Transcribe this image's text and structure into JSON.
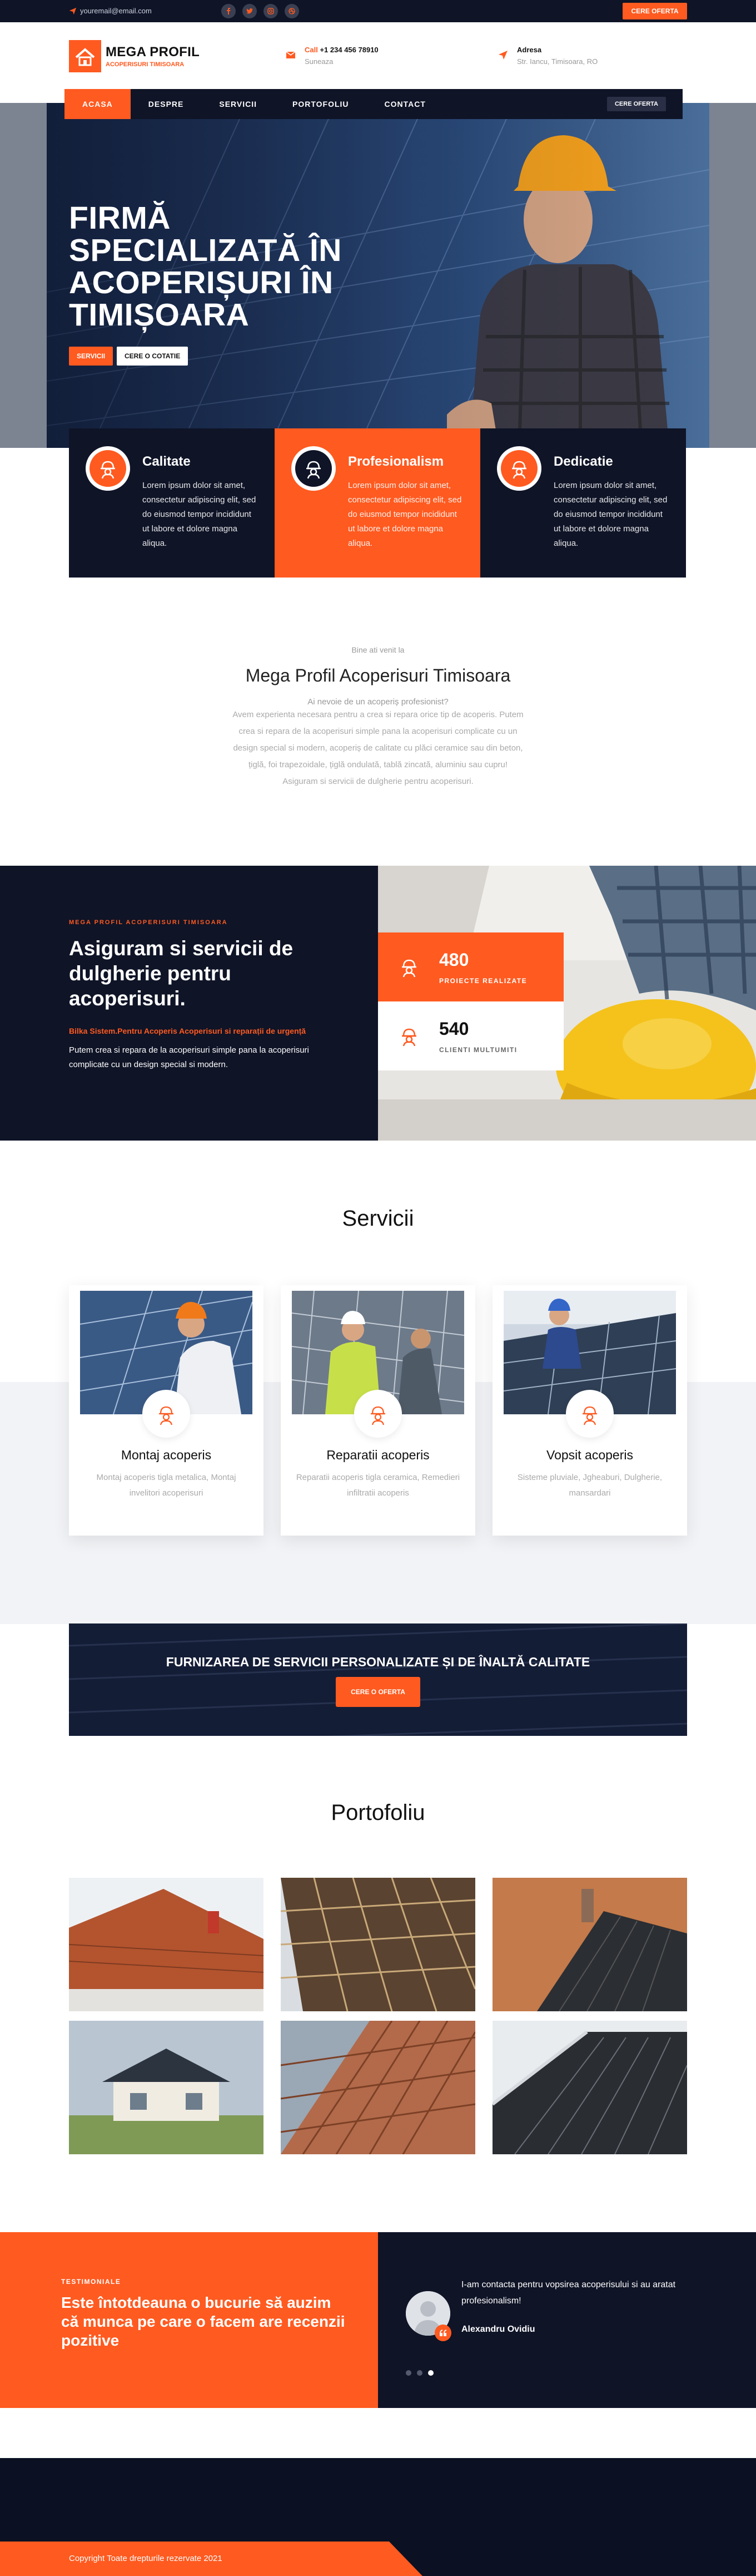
{
  "topbar": {
    "email": "youremail@email.com",
    "cta": "CERE OFERTA",
    "social": [
      "facebook-icon",
      "twitter-icon",
      "instagram-icon",
      "dribbble-icon"
    ]
  },
  "header": {
    "logo_title": "MEGA PROFIL",
    "logo_sub": "ACOPERISURI TIMISOARA",
    "call_label": "Call",
    "call_number": "+1 234 456 78910",
    "call_sub": "Suneaza",
    "addr_label": "Adresa",
    "addr_sub": "Str. Iancu, Timisoara, RO"
  },
  "nav": {
    "items": [
      "ACASA",
      "DESPRE",
      "SERVICII",
      "PORTOFOLIU",
      "CONTACT"
    ],
    "active": 0,
    "cta": "CERE OFERTA"
  },
  "hero": {
    "title": "FIRMĂ SPECIALIZATĂ ÎN ACOPERIȘURI ÎN TIMIȘOARA",
    "btn1": "SERVICII",
    "btn2": "CERE O COTATIE"
  },
  "features": [
    {
      "title": "Calitate",
      "text": "Lorem ipsum dolor sit amet, consectetur adipiscing elit, sed do eiusmod tempor incididunt ut labore et dolore magna aliqua.",
      "bg": "#0f1427",
      "icon": "quality-worker-icon"
    },
    {
      "title": "Profesionalism",
      "text": "Lorem ipsum dolor sit amet, consectetur adipiscing elit, sed do eiusmod tempor incididunt ut labore et dolore magna aliqua.",
      "bg": "#ff5a20",
      "icon": "professional-worker-icon"
    },
    {
      "title": "Dedicatie",
      "text": "Lorem ipsum dolor sit amet, consectetur adipiscing elit, sed do eiusmod tempor incididunt ut labore et dolore magna aliqua.",
      "bg": "#0f1427",
      "icon": "dedication-worker-icon"
    }
  ],
  "welcome": {
    "small": "Bine ati venit la",
    "title": "Mega Profil Acoperisuri Timisoara",
    "question": "Ai nevoie de un acoperiș profesionist?",
    "lines": [
      "Avem experienta necesara pentru a crea si repara orice tip de acoperis. Putem",
      "crea si repara de la acoperisuri simple pana la acoperisuri complicate cu un",
      "design special si modern, acoperiș de calitate cu plăci ceramice sau din beton,",
      "țiglă, foi trapezoidale, țiglă ondulată, tablă zincată, aluminiu sau cupru!",
      "Asiguram si servicii de dulgherie pentru acoperisuri."
    ]
  },
  "dulgherie": {
    "kicker": "MEGA PROFIL ACOPERISURI TIMISOARA",
    "title": "Asiguram si servicii de dulgherie pentru acoperisuri.",
    "orange": "Bilka Sistem.Pentru Acoperis Acoperisuri si reparații de urgență",
    "text": "Putem crea si repara de la acoperisuri simple pana la acoperisuri complicate cu un design special si modern.",
    "stats": [
      {
        "number": "480",
        "label": "PROIECTE REALIZATE"
      },
      {
        "number": "540",
        "label": "CLIENTI MULTUMITI"
      }
    ]
  },
  "servicii": {
    "title": "Servicii",
    "items": [
      {
        "title": "Montaj acoperis",
        "text": "Montaj acoperis tigla metalica, Montaj invelitori acoperisuri",
        "icon": "roof-install-icon"
      },
      {
        "title": "Reparatii acoperis",
        "text": "Reparatii acoperis tigla ceramica, Remedieri infiltratii acoperis",
        "icon": "roof-repair-icon"
      },
      {
        "title": "Vopsit acoperis",
        "text": "Sisteme pluviale, Jgheaburi, Dulgherie, mansardari",
        "icon": "roof-paint-icon"
      }
    ]
  },
  "cta": {
    "text": "FURNIZAREA DE SERVICII PERSONALIZATE ȘI DE ÎNALTĂ CALITATE",
    "button": "CERE O OFERTA"
  },
  "portofoliu": {
    "title": "Portofoliu"
  },
  "testimonials": {
    "kicker": "TESTIMONIALE",
    "title": "Este întotdeauna o bucurie să auzim că munca pe care o facem are recenzii pozitive",
    "quote": "I-am contacta pentru vopsirea acoperisului si au aratat profesionalism!",
    "name": "Alexandru Ovidiu",
    "active_dot": 2
  },
  "footer": {
    "copyright": "Copyright Toate drepturile rezervate 2021"
  },
  "colors": {
    "accent": "#ff5a20",
    "navy": "#0f1427"
  }
}
